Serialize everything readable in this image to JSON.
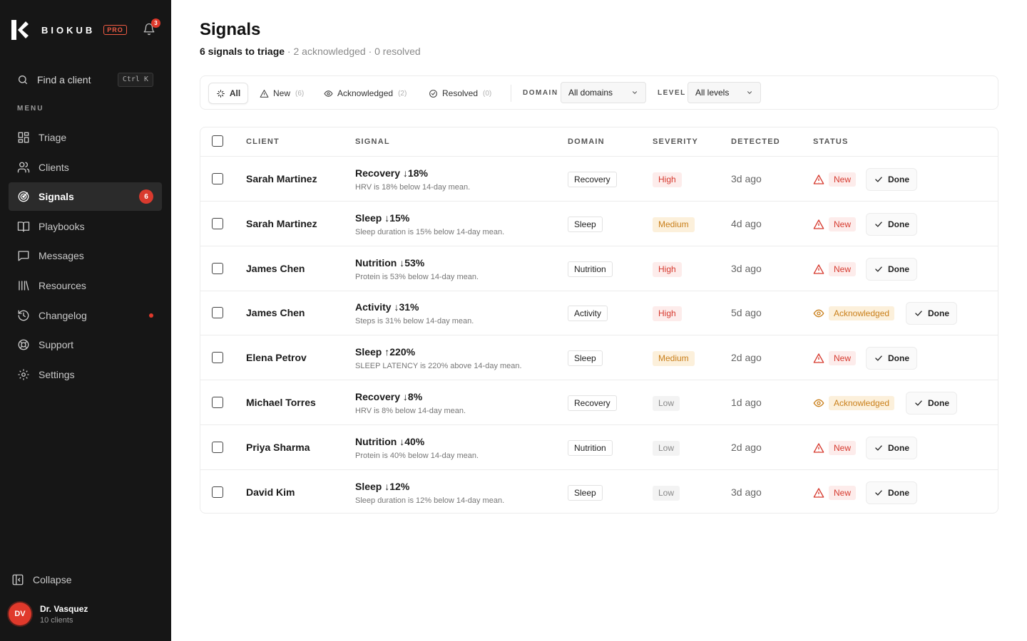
{
  "brand": {
    "name": "BIOKUB",
    "tier": "PRO",
    "notifications": "3"
  },
  "search": {
    "label": "Find a client",
    "shortcut": "Ctrl K"
  },
  "menu_label": "MENU",
  "nav": [
    {
      "label": "Triage",
      "icon": "grid-icon"
    },
    {
      "label": "Clients",
      "icon": "users-icon"
    },
    {
      "label": "Signals",
      "icon": "signal-target-icon",
      "badge": "6",
      "active": true
    },
    {
      "label": "Playbooks",
      "icon": "book-icon"
    },
    {
      "label": "Messages",
      "icon": "message-icon"
    },
    {
      "label": "Resources",
      "icon": "library-icon"
    },
    {
      "label": "Changelog",
      "icon": "history-icon",
      "dot": true
    },
    {
      "label": "Support",
      "icon": "lifebuoy-icon"
    },
    {
      "label": "Settings",
      "icon": "gear-icon"
    }
  ],
  "collapse_label": "Collapse",
  "user": {
    "initials": "DV",
    "name": "Dr. Vasquez",
    "sub": "10 clients"
  },
  "page": {
    "title": "Signals",
    "summary_strong": "6 signals to triage",
    "summary_rest": " · 2 acknowledged · 0 resolved"
  },
  "filters": {
    "tabs": [
      {
        "label": "All",
        "count": ""
      },
      {
        "label": "New",
        "count": "(6)"
      },
      {
        "label": "Acknowledged",
        "count": "(2)"
      },
      {
        "label": "Resolved",
        "count": "(0)"
      }
    ],
    "domain_label": "DOMAIN",
    "domain_value": "All domains",
    "level_label": "LEVEL",
    "level_value": "All levels"
  },
  "table": {
    "headers": {
      "client": "CLIENT",
      "signal": "SIGNAL",
      "domain": "DOMAIN",
      "severity": "SEVERITY",
      "detected": "DETECTED",
      "status": "STATUS"
    },
    "done_label": "Done",
    "rows": [
      {
        "client": "Sarah Martinez",
        "signal": "Recovery ↓18%",
        "desc": "HRV is 18% below 14-day mean.",
        "domain": "Recovery",
        "severity": "High",
        "detected": "3d ago",
        "status": "New"
      },
      {
        "client": "Sarah Martinez",
        "signal": "Sleep ↓15%",
        "desc": "Sleep duration is 15% below 14-day mean.",
        "domain": "Sleep",
        "severity": "Medium",
        "detected": "4d ago",
        "status": "New"
      },
      {
        "client": "James Chen",
        "signal": "Nutrition ↓53%",
        "desc": "Protein is 53% below 14-day mean.",
        "domain": "Nutrition",
        "severity": "High",
        "detected": "3d ago",
        "status": "New"
      },
      {
        "client": "James Chen",
        "signal": "Activity ↓31%",
        "desc": "Steps is 31% below 14-day mean.",
        "domain": "Activity",
        "severity": "High",
        "detected": "5d ago",
        "status": "Acknowledged"
      },
      {
        "client": "Elena Petrov",
        "signal": "Sleep ↑220%",
        "desc": "SLEEP LATENCY is 220% above 14-day mean.",
        "domain": "Sleep",
        "severity": "Medium",
        "detected": "2d ago",
        "status": "New"
      },
      {
        "client": "Michael Torres",
        "signal": "Recovery ↓8%",
        "desc": "HRV is 8% below 14-day mean.",
        "domain": "Recovery",
        "severity": "Low",
        "detected": "1d ago",
        "status": "Acknowledged"
      },
      {
        "client": "Priya Sharma",
        "signal": "Nutrition ↓40%",
        "desc": "Protein is 40% below 14-day mean.",
        "domain": "Nutrition",
        "severity": "Low",
        "detected": "2d ago",
        "status": "New"
      },
      {
        "client": "David Kim",
        "signal": "Sleep ↓12%",
        "desc": "Sleep duration is 12% below 14-day mean.",
        "domain": "Sleep",
        "severity": "Low",
        "detected": "3d ago",
        "status": "New"
      }
    ]
  },
  "colors": {
    "accent": "#e0392b",
    "sidebar_bg": "#161616",
    "high": "#d63a2f",
    "medium": "#c97f1a",
    "low": "#888888"
  }
}
